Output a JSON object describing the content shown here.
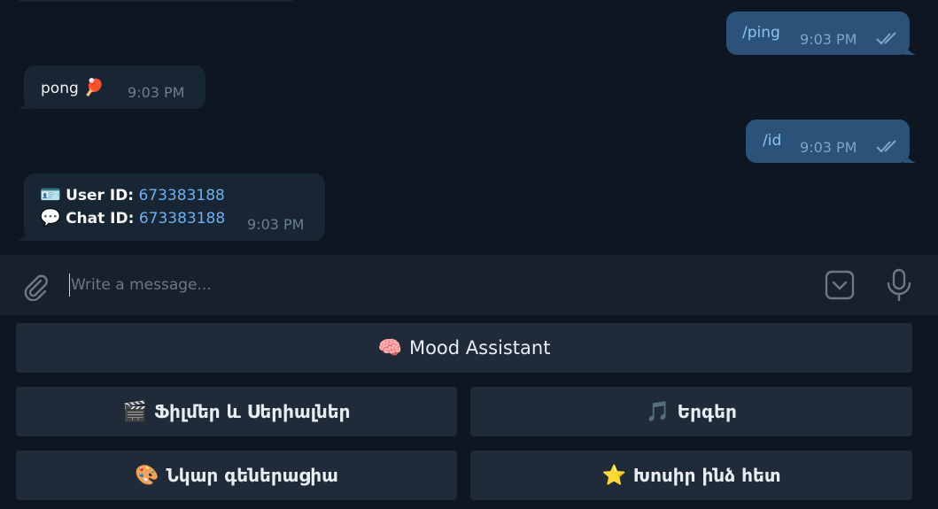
{
  "messages": [
    {
      "direction": "outgoing",
      "text": "/ping",
      "time": "9:03 PM",
      "status": "read"
    },
    {
      "direction": "incoming",
      "text": "pong",
      "emoji": "🏓",
      "time": "9:03 PM"
    },
    {
      "direction": "outgoing",
      "text": "/id",
      "time": "9:03 PM",
      "status": "read"
    },
    {
      "direction": "incoming",
      "time": "9:03 PM",
      "lines": [
        {
          "emoji": "🪪",
          "label": "User ID:",
          "value": "673383188"
        },
        {
          "emoji": "💬",
          "label": "Chat ID:",
          "value": "673383188"
        }
      ]
    }
  ],
  "composer": {
    "placeholder": "Write a message..."
  },
  "keyboard": {
    "rows": [
      [
        {
          "emoji": "🧠",
          "label": "Mood Assistant"
        }
      ],
      [
        {
          "emoji": "🎬",
          "label": "Ֆիլմեր և Սերիալներ"
        },
        {
          "emoji": "🎵",
          "label": "Երգեր"
        }
      ],
      [
        {
          "emoji": "🎨",
          "label": "Նկար գեներացիա"
        },
        {
          "emoji": "⭐",
          "label": "Խոսիր ինձ հետ"
        }
      ]
    ]
  },
  "colors": {
    "background": "#0e1621",
    "outgoing_bubble": "#2b5278",
    "incoming_bubble": "#182533",
    "composer": "#17212b",
    "keyboard_button": "#1f2b38",
    "link": "#6ab2f2"
  },
  "icons": [
    "paperclip-icon",
    "bot-keyboard-icon",
    "microphone-icon",
    "double-check-icon"
  ]
}
